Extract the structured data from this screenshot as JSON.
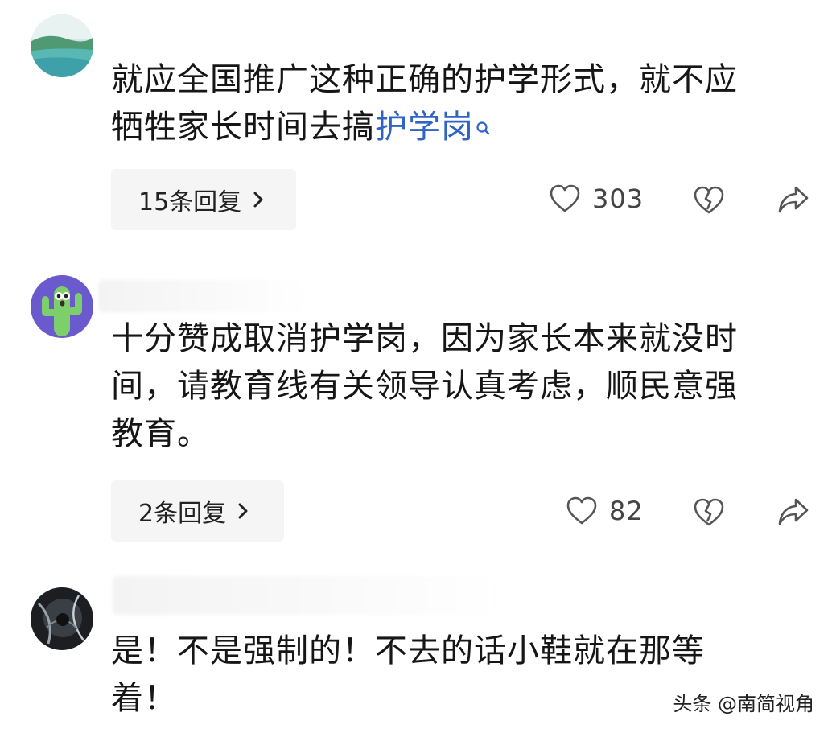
{
  "comments": [
    {
      "text_plain": "就应全国推广这种正确的护学形式，就不应\n牺牲家长时间去搞",
      "link_text": "护学岗",
      "reply_label": "15条回复",
      "likes": "303"
    },
    {
      "text_plain": "十分赞成取消护学岗，因为家长本来就没时\n间，请教育线有关领导认真考虑，顺民意强\n教育。",
      "reply_label": "2条回复",
      "likes": "82"
    },
    {
      "text_plain": "是！不是强制的！不去的话小鞋就在那等\n着！"
    }
  ],
  "watermark": "头条 @南简视角",
  "colors": {
    "link": "#2f64c4",
    "reply_bg": "#f5f5f5",
    "icon": "#555555"
  },
  "icons": [
    "heart-icon",
    "broken-heart-icon",
    "share-icon",
    "search-icon",
    "chevron-right-icon"
  ]
}
